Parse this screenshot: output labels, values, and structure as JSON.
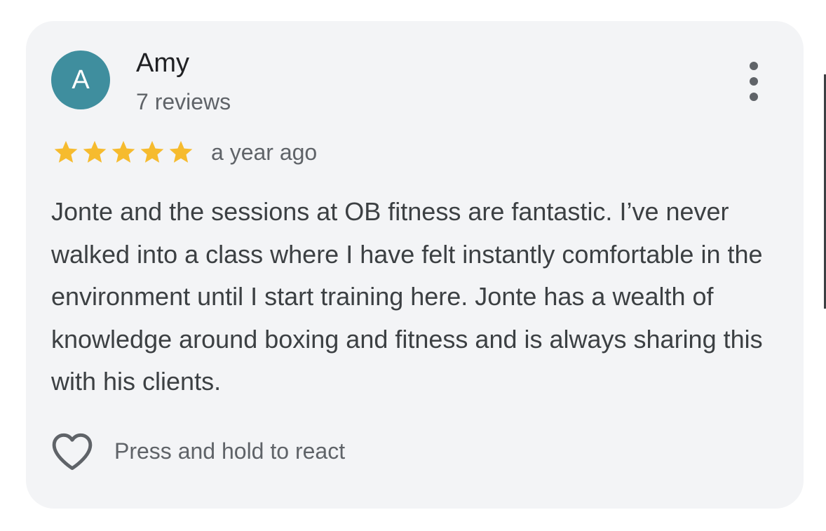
{
  "review": {
    "author": {
      "initial": "A",
      "name": "Amy",
      "review_count": "7 reviews",
      "avatar_color": "#3f8e9e"
    },
    "rating": {
      "stars": 5,
      "max_stars": 5,
      "star_color": "#f6bb2e"
    },
    "date": "a year ago",
    "text": "Jonte and the sessions at OB fitness are fantastic. I’ve never walked into a class where I have felt instantly comfortable in the environment until I start training here. Jonte has a wealth of knowledge around boxing and fitness and is always sharing this with his clients.",
    "react_hint": "Press and hold to react",
    "icons": {
      "menu": "more-vertical-icon",
      "star": "star-icon",
      "react": "heart-outline-icon"
    }
  }
}
